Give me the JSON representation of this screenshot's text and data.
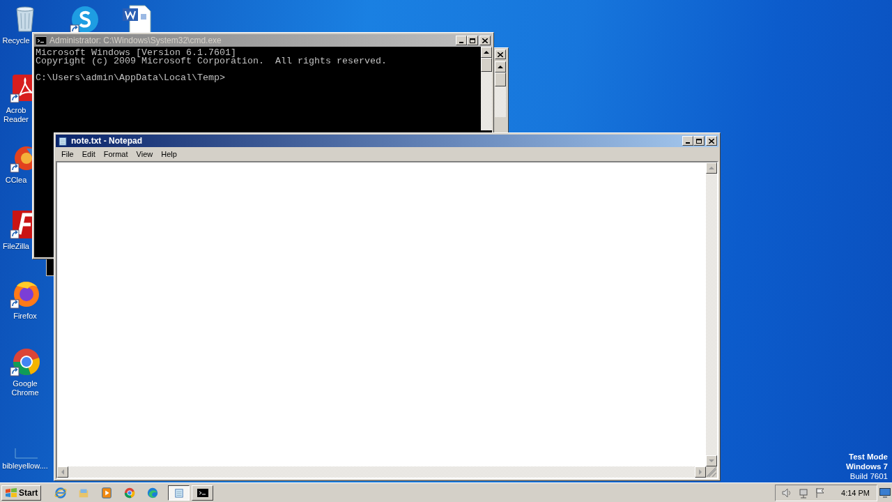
{
  "desktop_icons": [
    {
      "kind": "recycle-bin",
      "lines": [
        "Recycle"
      ]
    },
    {
      "kind": "pdf",
      "lines": [
        "Acrob",
        "Reader"
      ]
    },
    {
      "kind": "cleaner",
      "lines": [
        "CClea"
      ]
    },
    {
      "kind": "ftp",
      "lines": [
        "FileZilla"
      ]
    },
    {
      "kind": "firefox",
      "lines": [
        "Firefox"
      ]
    },
    {
      "kind": "chrome",
      "lines": [
        "Google",
        "Chrome"
      ]
    },
    {
      "kind": "file",
      "lines": [
        "bibleyellow...."
      ]
    },
    {
      "kind": "skype"
    },
    {
      "kind": "word"
    }
  ],
  "cmd_window": {
    "title": "Administrator: C:\\Windows\\System32\\cmd.exe",
    "lines": [
      "Microsoft Windows [Version 6.1.7601]",
      "Copyright (c) 2009 Microsoft Corporation.  All rights reserved.",
      "C:\\Users\\admin\\AppData\\Local\\Temp>"
    ]
  },
  "notepad_window": {
    "title": "note.txt - Notepad",
    "menu": [
      "File",
      "Edit",
      "Format",
      "View",
      "Help"
    ]
  },
  "watermark": {
    "lines": [
      "Test Mode",
      "Windows 7",
      "Build 7601"
    ]
  },
  "taskbar": {
    "start": "Start",
    "quick_launch": [
      {
        "kind": "ie"
      },
      {
        "kind": "explorer"
      },
      {
        "kind": "media"
      },
      {
        "kind": "chrome"
      },
      {
        "kind": "edge"
      }
    ],
    "tasks": [
      {
        "kind": "notepad",
        "selected": true
      },
      {
        "kind": "cmd",
        "selected": false
      }
    ],
    "clock": "4:14 PM"
  }
}
